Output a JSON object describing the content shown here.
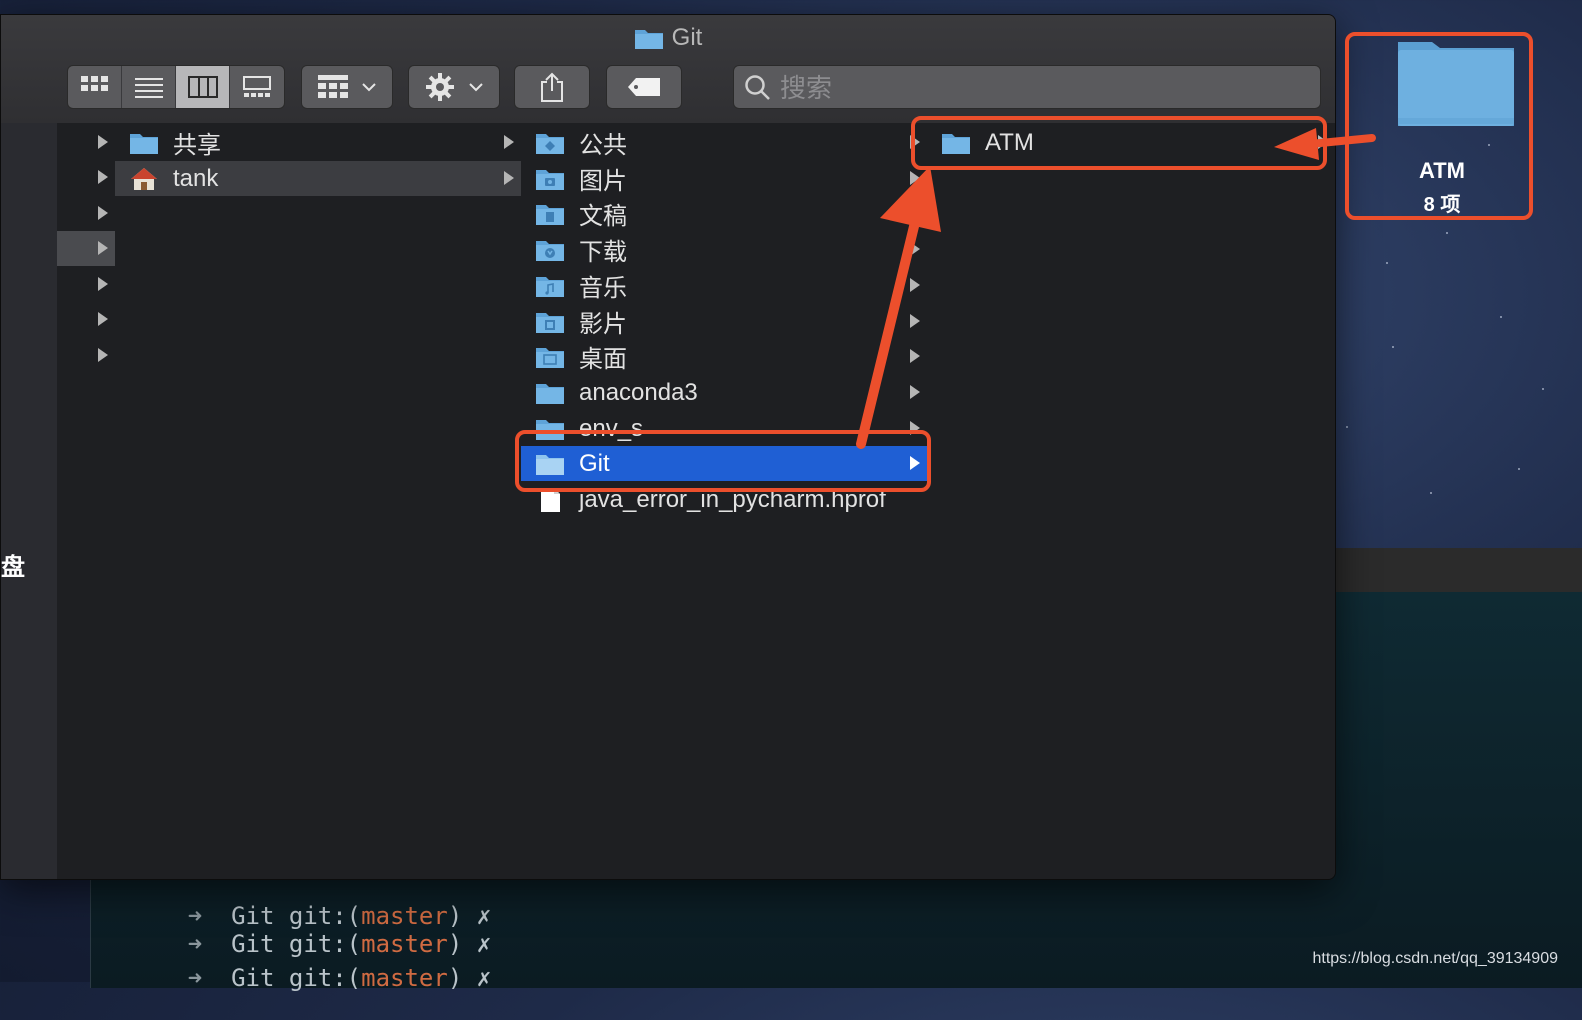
{
  "window": {
    "title": "Git"
  },
  "search": {
    "placeholder": "搜索"
  },
  "sidebar": {
    "partial_label": "盘"
  },
  "columns": {
    "col1": [
      {
        "label": "共享",
        "icon": "shared-folder-icon",
        "has_children": true,
        "hovered": false
      },
      {
        "label": "tank",
        "icon": "home-icon",
        "has_children": true,
        "hovered": true
      }
    ],
    "col2": [
      {
        "label": "公共",
        "icon": "public-folder-icon",
        "has_children": true
      },
      {
        "label": "图片",
        "icon": "pictures-folder-icon",
        "has_children": true
      },
      {
        "label": "文稿",
        "icon": "documents-folder-icon",
        "has_children": true
      },
      {
        "label": "下载",
        "icon": "downloads-folder-icon",
        "has_children": true
      },
      {
        "label": "音乐",
        "icon": "music-folder-icon",
        "has_children": true
      },
      {
        "label": "影片",
        "icon": "movies-folder-icon",
        "has_children": true
      },
      {
        "label": "桌面",
        "icon": "desktop-folder-icon",
        "has_children": true
      },
      {
        "label": "anaconda3",
        "icon": "folder-icon",
        "has_children": true
      },
      {
        "label": "env_s",
        "icon": "folder-icon",
        "has_children": true
      },
      {
        "label": "Git",
        "icon": "folder-icon",
        "has_children": true,
        "selected": true
      },
      {
        "label": "java_error_in_pycharm.hprof",
        "icon": "file-icon",
        "has_children": false
      }
    ],
    "col3": [
      {
        "label": "ATM",
        "icon": "folder-icon",
        "has_children": true
      }
    ]
  },
  "desktop_item": {
    "name": "ATM",
    "count": "8 项"
  },
  "terminal": {
    "lines": [
      {
        "arrow": "➜",
        "dir": "Git",
        "git_prefix": "git:(",
        "branch": "master",
        "git_suffix": ")",
        "dirty": "✗"
      },
      {
        "arrow": "➜",
        "dir": "Git",
        "git_prefix": "git:(",
        "branch": "master",
        "git_suffix": ")",
        "dirty": "✗"
      },
      {
        "arrow": "➜",
        "dir": "Git",
        "git_prefix": "git:(",
        "branch": "master",
        "git_suffix": ")",
        "dirty": "✗"
      }
    ]
  },
  "watermark": "https://blog.csdn.net/qq_39134909",
  "colors": {
    "accent_selected": "#1f5fd4",
    "annotation": "#ec4f2c",
    "folder_blue": "#6aa9d8"
  }
}
